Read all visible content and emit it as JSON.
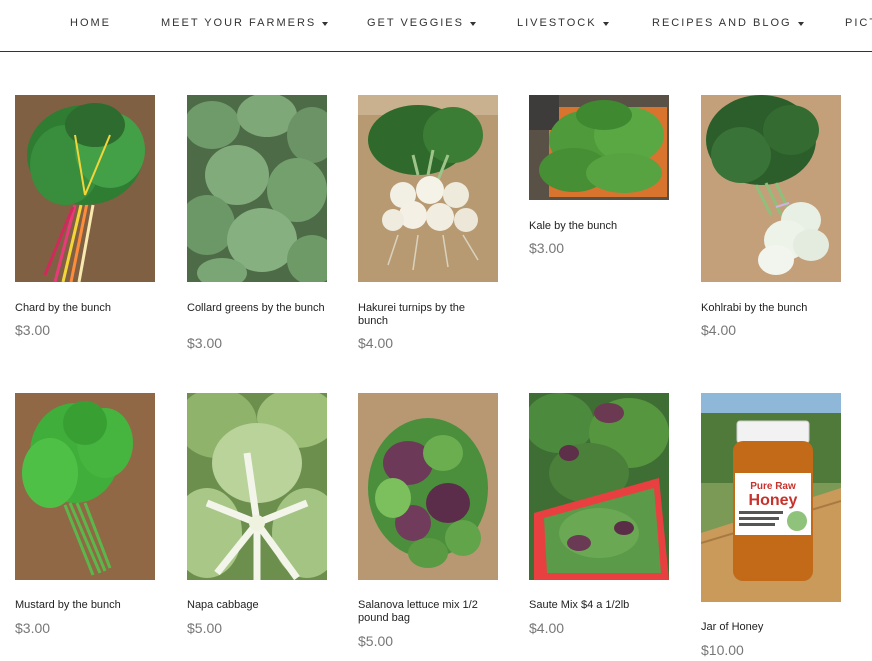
{
  "nav": {
    "items": [
      {
        "label": "HOME",
        "dropdown": false
      },
      {
        "label": "MEET YOUR FARMERS",
        "dropdown": true
      },
      {
        "label": "GET VEGGIES",
        "dropdown": true
      },
      {
        "label": "LIVESTOCK",
        "dropdown": true
      },
      {
        "label": "RECIPES AND BLOG",
        "dropdown": true
      },
      {
        "label": "PICT",
        "dropdown": false
      }
    ]
  },
  "products": [
    {
      "name": "Chard by the bunch",
      "price": "$3.00",
      "image": "rainbow-chard"
    },
    {
      "name": "Collard greens by the bunch",
      "price": "$3.00",
      "image": "collard-greens"
    },
    {
      "name": "Hakurei turnips by the bunch",
      "price": "$4.00",
      "image": "hakurei-turnips"
    },
    {
      "name": "Kale by the bunch",
      "price": "$3.00",
      "image": "kale-crate"
    },
    {
      "name": "Kohlrabi by the bunch",
      "price": "$4.00",
      "image": "kohlrabi"
    },
    {
      "name": "Mustard by the bunch",
      "price": "$3.00",
      "image": "mustard-greens"
    },
    {
      "name": "Napa cabbage",
      "price": "$5.00",
      "image": "napa-cabbage"
    },
    {
      "name": "Salanova lettuce mix 1/2 pound bag",
      "price": "$5.00",
      "image": "lettuce-mix"
    },
    {
      "name": "Saute Mix $4 a 1/2lb",
      "price": "$4.00",
      "image": "saute-mix"
    },
    {
      "name": "Jar of Honey",
      "price": "$10.00",
      "image": "honey-jar",
      "label_text": {
        "line1": "Pure Raw",
        "line2": "Honey"
      }
    }
  ]
}
